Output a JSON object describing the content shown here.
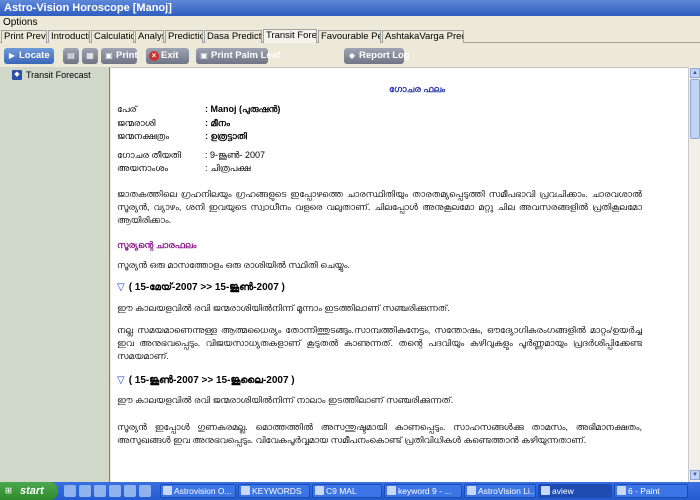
{
  "window": {
    "title": "Astro-Vision Horoscope [Manoj]"
  },
  "menu": {
    "options": "Options"
  },
  "tabs": [
    "Print Preview",
    "Introduction",
    "Calculations",
    "Analysis",
    "Predictions",
    "Dasa Predictions",
    "Transit Forecast",
    "Favourable Periods",
    "AshtakaVarga Predictions"
  ],
  "active_tab": "Transit Forecast",
  "toolbar": {
    "locate": "Locate",
    "print": "Print",
    "exit": "Exit",
    "print_palm_leaf": "Print Palm Leaf",
    "report_log": "Report Log"
  },
  "tree": {
    "transit_forecast": "Transit Forecast"
  },
  "report": {
    "heading": "ഗോചര ഫലം",
    "info": [
      {
        "label": "പേര്",
        "value": ": Manoj (പുരുഷൻ)"
      },
      {
        "label": "ജന്മരാശി",
        "value": ": മീനം"
      },
      {
        "label": "ജന്മനക്ഷത്രം",
        "value": ": ഉത്രട്ടാതി"
      },
      {
        "label": "ഗോചര തീയതി",
        "value": ": 9-ജൂൺ- 2007"
      },
      {
        "label": "അയനാംശം",
        "value": ": ചിത്രപക്ഷ"
      }
    ],
    "intro": "ജാതകത്തിലെ ഗ്രഹനിലയും ഗ്രഹങ്ങളുടെ ഇപ്പോഴത്തെ ചാരസ്ഥിതിയും താരതമ്യപ്പെടുത്തി സമീപഭാവി പ്രവചിക്കാം. ചാരവശാൽ സൂര്യൻ, വ്യാഴം, ശനി ഇവയുടെ സ്വാധീനം വളരെ വലുതാണ്. ചിലപ്പോൾ അനുകൂലമോ മറ്റു ചില അവസരങ്ങളിൽ പ്രതികൂലമോ ആയിരിക്കാം.",
    "sun_title": "സൂര്യന്റെ ചാരഫലം",
    "sun_intro": "സൂര്യൻ ഒരു മാസത്തോളം ഒരു രാശിയിൽ സ്ഥിതി ചെയ്യും.",
    "periods": [
      {
        "range": "( 15-മേയ്-2007  >>  15-ജൂൺ-2007 )",
        "line1": "ഈ കാലയളവിൽ രവി ജന്മരാശിയിൽനിന്ന് മൂന്നാം ഇടത്തിലാണ് സഞ്ചരിക്കുന്നത്.",
        "line2": "നല്ല സമയമാണെന്നുള്ള ആത്മധൈര്യം തോന്നിത്തുടങ്ങും.സാമ്പത്തികനേട്ടം, സന്തോഷം, ഔദ്യോഗികരംഗങ്ങളിൽ മാറ്റം/ഉയർച്ച ഇവ അനുഭവപ്പെടും. വിജയസാധ്യതകളാണ് കൂടുതൽ കാണുന്നത്. തന്റെ പദവിയും കഴിവുകളും പൂർണ്ണമായും പ്രദർശിപ്പിക്കേണ്ട സമയമാണ്."
      },
      {
        "range": "( 15-ജൂൺ-2007  >>  15-ജൂലൈ-2007 )",
        "line1": "ഈ കാലയളവിൽ രവി ജന്മരാശിയിൽനിന്ന് നാലാം ഇടത്തിലാണ് സഞ്ചരിക്കുന്നത്.",
        "line2": "സൂര്യൻ ഇപ്പോൾ ഗുണകരമല്ല. മൊത്തത്തിൽ അസന്തുഷ്ടമായി കാണപ്പെടും. സാഹസങ്ങൾക്കു താമസം, അഭിമാനക്ഷതം, അസുഖങ്ങൾ ഇവ അനുഭവപ്പെടും. വിവേകപൂർവ്വമായ സമീപനംകൊണ്ട് പ്രതിവിധികൾ കണ്ടെത്താൻ കഴിയുന്നതാണ്."
      }
    ]
  },
  "taskbar": {
    "start": "start",
    "items": [
      "Astrovision O...",
      "KEYWORDS",
      "C9 MAL",
      "keyword 9 - ...",
      "AstroVision Li...",
      "aview",
      "6 - Paint"
    ]
  },
  "colors": {
    "title_bar": "#2f5cc0",
    "section_title": "#8b1a8b",
    "report_heading": "#2233aa",
    "period_marker": "#1a3fd8",
    "taskbar": "#245ad0"
  }
}
